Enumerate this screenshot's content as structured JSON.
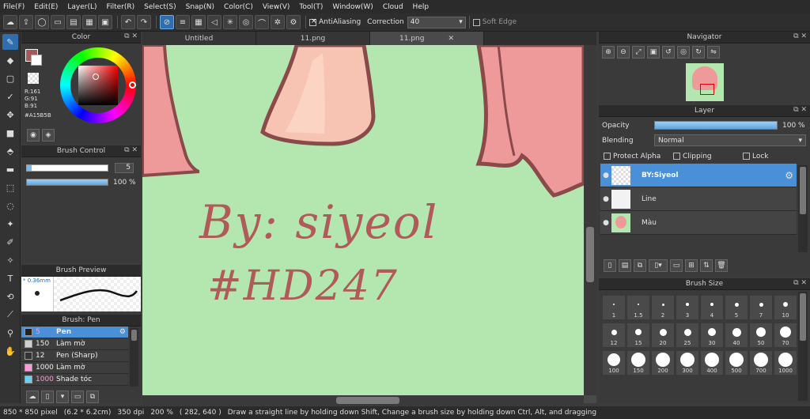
{
  "menu": [
    "File(F)",
    "Edit(E)",
    "Layer(L)",
    "Filter(R)",
    "Select(S)",
    "Snap(N)",
    "Color(C)",
    "View(V)",
    "Tool(T)",
    "Window(W)",
    "Cloud",
    "Help"
  ],
  "toolbar": {
    "antialiasing_label": "AntiAliasing",
    "correction_label": "Correction",
    "correction_value": "40",
    "soft_edge_label": "Soft Edge"
  },
  "tabs": [
    "Untitled",
    "11.png",
    "11.png"
  ],
  "color_panel": {
    "title": "Color",
    "r": "R:161",
    "g": "G:91",
    "b": "B:91",
    "hex": "#A15B5B",
    "primary": "#a15b5b"
  },
  "brush_control": {
    "title": "Brush Control",
    "size_value": "5",
    "opacity_value": "100 %",
    "opacity_fraction": 1.0
  },
  "brush_preview": {
    "title": "Brush Preview",
    "size_text": "* 0.36mm"
  },
  "brush_list": {
    "title": "Brush: Pen",
    "items": [
      {
        "size": "5",
        "name": "Pen",
        "color": "#222222"
      },
      {
        "size": "150",
        "name": "Làm mờ",
        "color": "#cfcfcf"
      },
      {
        "size": "12",
        "name": "Pen (Sharp)",
        "color": "#333333"
      },
      {
        "size": "1000",
        "name": "Làm mờ",
        "color": "#ff9ad8"
      },
      {
        "size": "1000",
        "name": "Shade tóc",
        "color": "#6ad0f0"
      }
    ]
  },
  "canvas": {
    "text_line1": "By: siyeol",
    "text_line2": "#HD247",
    "bg_color": "#b4e6b0"
  },
  "navigator": {
    "title": "Navigator"
  },
  "layer_panel": {
    "title": "Layer",
    "opacity_label": "Opacity",
    "opacity_value": "100 %",
    "opacity_fraction": 1.0,
    "blending_label": "Blending",
    "blending_value": "Normal",
    "protect_alpha": "Protect Alpha",
    "clipping": "Clipping",
    "lock": "Lock",
    "layers": [
      {
        "name": "BY:Siyeol",
        "selected": true
      },
      {
        "name": "Line",
        "selected": false
      },
      {
        "name": "Màu",
        "selected": false
      }
    ]
  },
  "brush_size": {
    "title": "Brush Size",
    "sizes": [
      "1",
      "1.5",
      "2",
      "3",
      "4",
      "5",
      "7",
      "10",
      "12",
      "15",
      "20",
      "25",
      "30",
      "40",
      "50",
      "70",
      "100",
      "150",
      "200",
      "300",
      "400",
      "500",
      "700",
      "1000"
    ]
  },
  "status": {
    "size": "850 * 850 pixel",
    "cm": "(6.2 * 6.2cm)",
    "dpi": "350 dpi",
    "zoom": "200 %",
    "coords": "( 282, 640 )",
    "hint": "Draw a straight line by holding down Shift, Change a brush size by holding down Ctrl, Alt, and dragging"
  }
}
